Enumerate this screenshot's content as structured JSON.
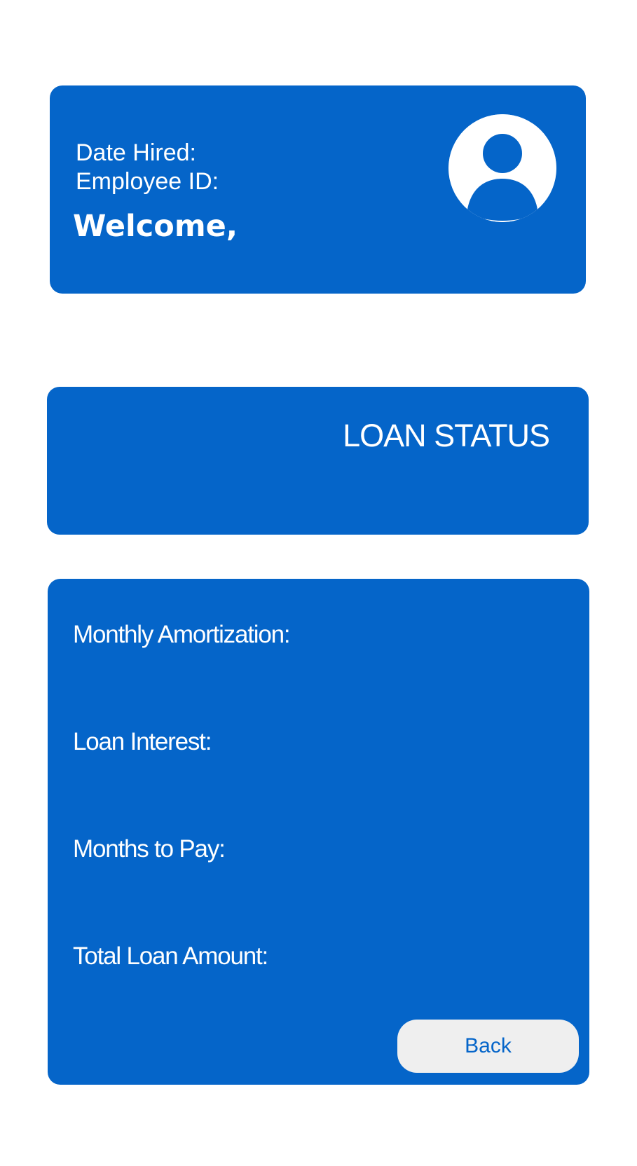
{
  "profile": {
    "date_hired_label": "Date Hired:",
    "employee_id_label": "Employee ID:",
    "welcome_text": "Welcome,",
    "avatar_icon": "user-avatar-icon"
  },
  "loan_status": {
    "title": "LOAN STATUS"
  },
  "details": {
    "monthly_amortization_label": "Monthly Amortization:",
    "loan_interest_label": "Loan Interest:",
    "months_to_pay_label": "Months to Pay:",
    "total_loan_amount_label": "Total Loan Amount:"
  },
  "actions": {
    "back_label": "Back"
  },
  "colors": {
    "primary": "#0565c9",
    "background": "#ffffff",
    "button_background": "#efefef",
    "text_on_primary": "#ffffff"
  }
}
